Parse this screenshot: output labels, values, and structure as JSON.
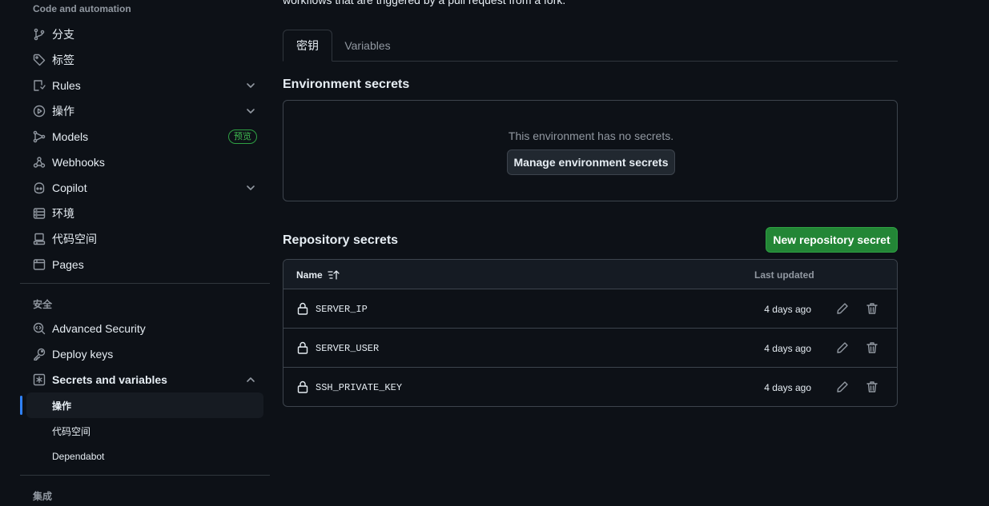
{
  "sidebar": {
    "section_code": "Code and automation",
    "items": [
      {
        "label": "分支",
        "icon": "branch-icon"
      },
      {
        "label": "标签",
        "icon": "tag-icon"
      },
      {
        "label": "Rules",
        "icon": "rules-icon"
      },
      {
        "label": "操作",
        "icon": "play-icon"
      },
      {
        "label": "Models",
        "icon": "models-icon",
        "badge": "预览"
      },
      {
        "label": "Webhooks",
        "icon": "webhook-icon"
      },
      {
        "label": "Copilot",
        "icon": "copilot-icon"
      },
      {
        "label": "环境",
        "icon": "server-icon"
      },
      {
        "label": "代码空间",
        "icon": "codespaces-icon"
      },
      {
        "label": "Pages",
        "icon": "browser-icon"
      }
    ],
    "section_security": "安全",
    "security_items": [
      {
        "label": "Advanced Security",
        "icon": "codescan-icon"
      },
      {
        "label": "Deploy keys",
        "icon": "key-icon"
      },
      {
        "label": "Secrets and variables",
        "icon": "asterisk-icon"
      }
    ],
    "sub_items": [
      {
        "label": "操作",
        "active": true
      },
      {
        "label": "代码空间"
      },
      {
        "label": "Dependabot"
      }
    ],
    "section_integrations": "集成"
  },
  "main": {
    "top_text": "workflows that are triggered by a pull request from a fork.",
    "tabs": [
      {
        "label": "密钥",
        "active": true
      },
      {
        "label": "Variables"
      }
    ],
    "env_heading": "Environment secrets",
    "env_empty": "This environment has no secrets.",
    "env_button": "Manage environment secrets",
    "repo_heading": "Repository secrets",
    "new_button": "New repository secret",
    "table": {
      "col_name": "Name",
      "col_updated": "Last updated",
      "rows": [
        {
          "name": "SERVER_IP",
          "updated": "4 days ago"
        },
        {
          "name": "SERVER_USER",
          "updated": "4 days ago"
        },
        {
          "name": "SSH_PRIVATE_KEY",
          "updated": "4 days ago"
        }
      ]
    }
  },
  "colors": {
    "background": "#0d1117",
    "accent_green": "#238636",
    "active_indicator": "#2f81f7",
    "border": "#3d444d"
  }
}
